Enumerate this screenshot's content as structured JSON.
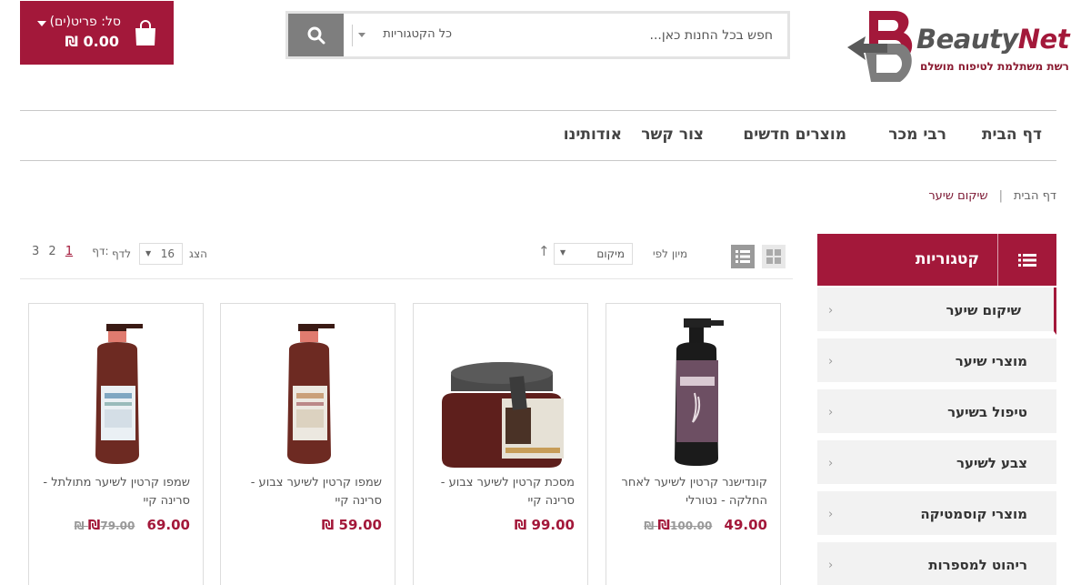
{
  "header": {
    "cart_label": "סל: פריט(ים)",
    "cart_total": "0.00 ₪",
    "search_placeholder": "חפש בכל החנות כאן...",
    "search_category": "כל הקטגוריות",
    "logo_word": "Beauty",
    "logo_word_accent": "Net",
    "logo_tagline": "רשת משתלמת לטיפוח מושלם"
  },
  "nav": [
    "דף הבית",
    "רבי מכר",
    "מוצרים חדשים",
    "צור קשר",
    "אודותינו"
  ],
  "breadcrumb": {
    "home": "דף הבית",
    "current": "שיקום שיער"
  },
  "sidebar": {
    "title": "קטגוריות",
    "items": [
      "שיקום שיער",
      "מוצרי שיער",
      "טיפול בשיער",
      "צבע לשיער",
      "מוצרי קוסמטיקה",
      "ריהוט למספרות"
    ]
  },
  "toolbar": {
    "sort_label": "מיון לפי",
    "sort_value": "מיקום",
    "show_label": "הצג",
    "show_value": "16",
    "per_page_label": "לדף",
    "pages_label": "דף:",
    "pages": [
      "1",
      "2",
      "3"
    ],
    "current_page": "1"
  },
  "products": [
    {
      "name": "קונדישנר קרטין לשיער לאחר החלקה - נטורלי",
      "price": "49.00 ₪",
      "old_price": "100.00 ₪"
    },
    {
      "name": "מסכת קרטין לשיער צבוע - סרינה קיי",
      "price": "99.00 ₪",
      "old_price": ""
    },
    {
      "name": "שמפו קרטין לשיער צבוע - סרינה קיי",
      "price": "59.00 ₪",
      "old_price": ""
    },
    {
      "name": "שמפו קרטין לשיער מתולתל - סרינה קיי",
      "price": "69.00 ₪",
      "old_price": "79.00 ₪"
    }
  ],
  "colors": {
    "accent": "#a3183a",
    "search_button": "#7e7e7e"
  },
  "icons": {
    "search": "search-icon",
    "cart": "shopping-bag-icon",
    "list": "list-icon",
    "grid": "grid-view-icon"
  }
}
